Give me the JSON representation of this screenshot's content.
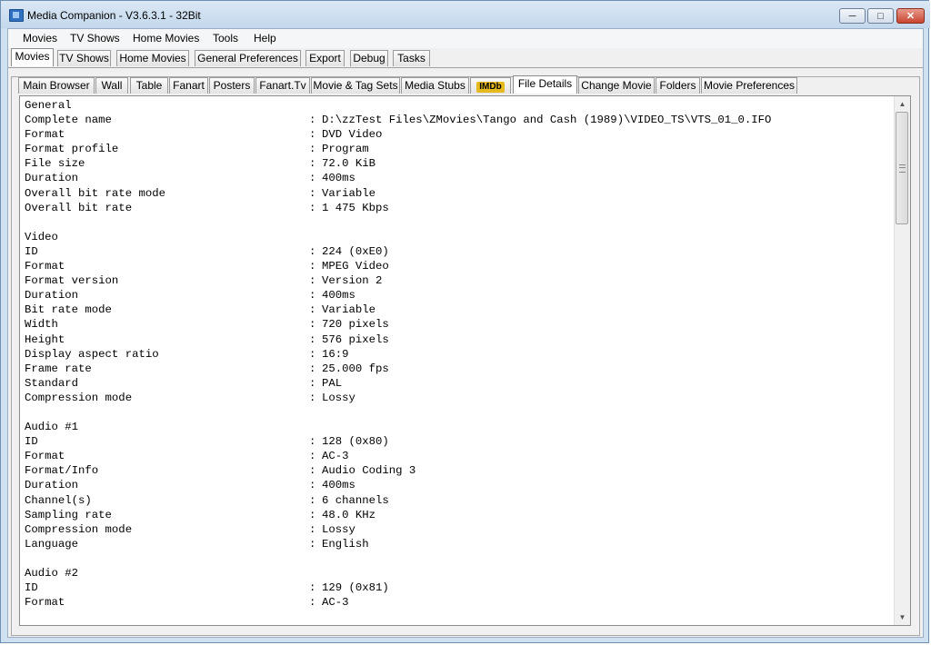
{
  "window": {
    "title": "Media Companion - V3.6.3.1 - 32Bit",
    "min_glyph": "─",
    "max_glyph": "□",
    "close_glyph": "✕"
  },
  "menu": [
    "Movies",
    "TV Shows",
    "Home Movies",
    "Tools",
    "Help"
  ],
  "main_tabs": [
    {
      "label": "Movies",
      "active": true
    },
    {
      "label": "TV Shows",
      "active": false
    },
    {
      "label": "Home Movies",
      "active": false
    },
    {
      "label": "General Preferences",
      "active": false
    },
    {
      "label": "Export",
      "active": false
    },
    {
      "label": "Debug",
      "active": false
    },
    {
      "label": "Tasks",
      "active": false
    }
  ],
  "movie_tabs": [
    {
      "label": "Main Browser",
      "active": false
    },
    {
      "label": "Wall",
      "active": false
    },
    {
      "label": "Table",
      "active": false
    },
    {
      "label": "Fanart",
      "active": false
    },
    {
      "label": "Posters",
      "active": false
    },
    {
      "label": "Fanart.Tv",
      "active": false
    },
    {
      "label": "Movie & Tag Sets",
      "active": false
    },
    {
      "label": "Media Stubs",
      "active": false
    },
    {
      "label": "IMDb",
      "active": false
    },
    {
      "label": "File Details",
      "active": true
    },
    {
      "label": "Change Movie",
      "active": false
    },
    {
      "label": "Folders",
      "active": false
    },
    {
      "label": "Movie Preferences",
      "active": false
    }
  ],
  "colors": {
    "imdb_badge": "#e6b91e",
    "close_button": "#c9452f"
  },
  "file_details": [
    {
      "section": "General"
    },
    {
      "key": "Complete name",
      "value": "D:\\zzTest Files\\ZMovies\\Tango and Cash (1989)\\VIDEO_TS\\VTS_01_0.IFO"
    },
    {
      "key": "Format",
      "value": "DVD Video"
    },
    {
      "key": "Format profile",
      "value": "Program"
    },
    {
      "key": "File size",
      "value": "72.0 KiB"
    },
    {
      "key": "Duration",
      "value": "400ms"
    },
    {
      "key": "Overall bit rate mode",
      "value": "Variable"
    },
    {
      "key": "Overall bit rate",
      "value": "1 475 Kbps"
    },
    {
      "blank": true
    },
    {
      "section": "Video"
    },
    {
      "key": "ID",
      "value": "224 (0xE0)"
    },
    {
      "key": "Format",
      "value": "MPEG Video"
    },
    {
      "key": "Format version",
      "value": "Version 2"
    },
    {
      "key": "Duration",
      "value": "400ms"
    },
    {
      "key": "Bit rate mode",
      "value": "Variable"
    },
    {
      "key": "Width",
      "value": "720 pixels"
    },
    {
      "key": "Height",
      "value": "576 pixels"
    },
    {
      "key": "Display aspect ratio",
      "value": "16:9"
    },
    {
      "key": "Frame rate",
      "value": "25.000 fps"
    },
    {
      "key": "Standard",
      "value": "PAL"
    },
    {
      "key": "Compression mode",
      "value": "Lossy"
    },
    {
      "blank": true
    },
    {
      "section": "Audio #1"
    },
    {
      "key": "ID",
      "value": "128 (0x80)"
    },
    {
      "key": "Format",
      "value": "AC-3"
    },
    {
      "key": "Format/Info",
      "value": "Audio Coding 3"
    },
    {
      "key": "Duration",
      "value": "400ms"
    },
    {
      "key": "Channel(s)",
      "value": "6 channels"
    },
    {
      "key": "Sampling rate",
      "value": "48.0 KHz"
    },
    {
      "key": "Compression mode",
      "value": "Lossy"
    },
    {
      "key": "Language",
      "value": "English"
    },
    {
      "blank": true
    },
    {
      "section": "Audio #2"
    },
    {
      "key": "ID",
      "value": "129 (0x81)"
    },
    {
      "key": "Format",
      "value": "AC-3"
    }
  ]
}
